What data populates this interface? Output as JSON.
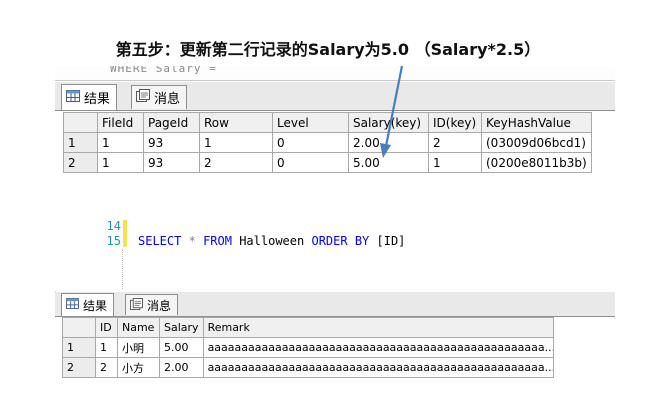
{
  "annotation": "第五步：更新第二行记录的Salary为5.0 （Salary*2.5）",
  "top_panel": {
    "cut_code": "WHERE Salary =",
    "tabs": [
      {
        "label": "结果",
        "icon": "grid-icon",
        "active": true
      },
      {
        "label": "消息",
        "icon": "message-icon",
        "active": false
      }
    ],
    "columns": [
      "FileId",
      "PageId",
      "Row",
      "Level",
      "Salary(key)",
      "ID(key)",
      "KeyHashValue"
    ],
    "rows": [
      {
        "num": "1",
        "cells": [
          "1",
          "93",
          "1",
          "0",
          "2.00",
          "2",
          "(03009d06bcd1)"
        ]
      },
      {
        "num": "2",
        "cells": [
          "1",
          "93",
          "2",
          "0",
          "5.00",
          "1",
          "(0200e8011b3b)"
        ]
      }
    ]
  },
  "editor": {
    "line14": "14",
    "line15": "15",
    "code": {
      "kw1": "SELECT",
      "star": "*",
      "kw2": "FROM",
      "table": "Halloween",
      "kw3": "ORDER BY",
      "col": "[ID]"
    }
  },
  "bottom_panel": {
    "tabs": [
      {
        "label": "结果",
        "icon": "grid-icon",
        "active": true
      },
      {
        "label": "消息",
        "icon": "message-icon",
        "active": false
      }
    ],
    "columns": [
      "ID",
      "Name",
      "Salary",
      "Remark"
    ],
    "rows": [
      {
        "num": "1",
        "cells": [
          "1",
          "小明",
          "5.00",
          "aaaaaaaaaaaaaaaaaaaaaaaaaaaaaaaaaaaaaaaaaaaaaaaaaa..."
        ]
      },
      {
        "num": "2",
        "cells": [
          "2",
          "小方",
          "2.00",
          "aaaaaaaaaaaaaaaaaaaaaaaaaaaaaaaaaaaaaaaaaaaaaaaaaa..."
        ]
      }
    ]
  },
  "colors": {
    "arrow": "#4a7ebb",
    "keyword": "#0000ff",
    "line_number": "#2b91af",
    "margin_marker": "#f5e34d"
  }
}
